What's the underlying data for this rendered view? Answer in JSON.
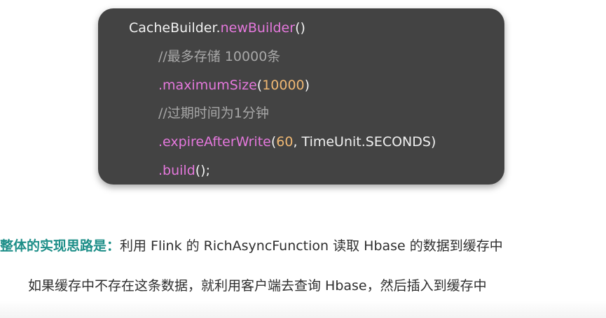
{
  "code": {
    "line1": {
      "class_name": "CacheBuilder",
      "dot": ".",
      "method": "newBuilder",
      "tail": "()"
    },
    "line2": {
      "comment": "//最多存储 10000条"
    },
    "line3": {
      "method": ".maximumSize",
      "open": "(",
      "num": "10000",
      "close": ")"
    },
    "line4": {
      "comment": "//过期时间为1分钟"
    },
    "line5": {
      "method": ".expireAfterWrite",
      "open": "(",
      "num": "60",
      "rest": ", TimeUnit.SECONDS)"
    },
    "line6": {
      "method": ".build",
      "tail": "();"
    }
  },
  "description": {
    "lead": "整体的实现思路是：",
    "line1_rest": "利用 Flink 的 RichAsyncFunction 读取 Hbase 的数据到缓存中",
    "line2": "如果缓存中不存在这条数据，就利用客户端去查询 Hbase，然后插入到缓存中"
  },
  "colors": {
    "card_background": "#434343",
    "method": "#e478dc",
    "number": "#f0b873",
    "comment": "#a8a8a8",
    "lead_text": "#1d8e88"
  }
}
